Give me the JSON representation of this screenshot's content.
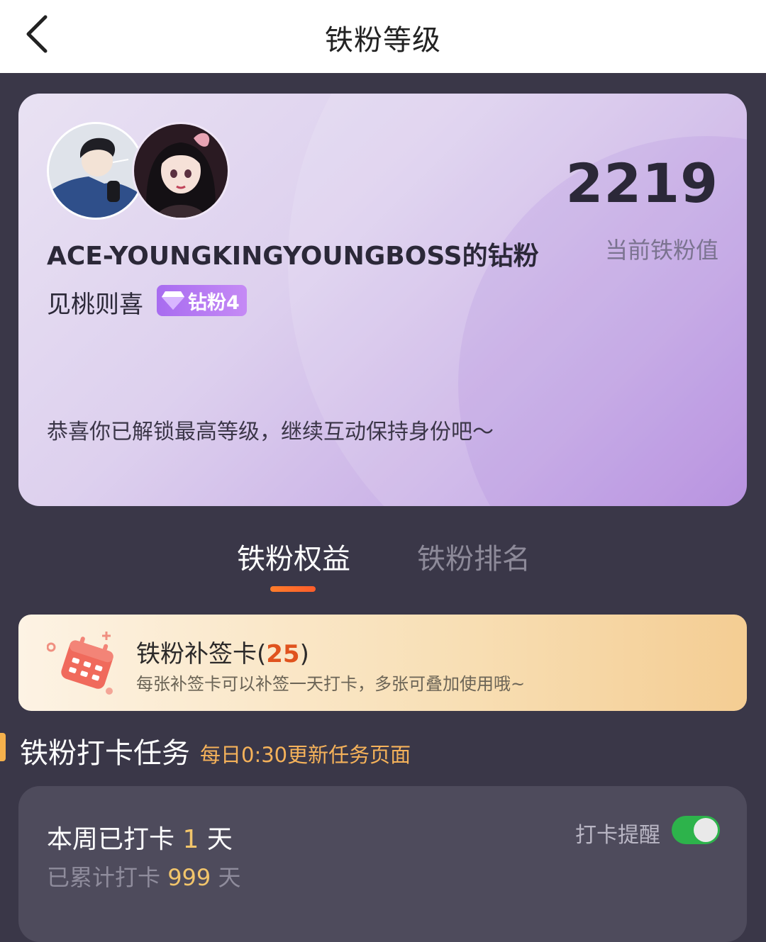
{
  "header": {
    "title": "铁粉等级",
    "back_icon": "chevron-left-icon"
  },
  "hero": {
    "fan_value": "2219",
    "fan_value_label": "当前铁粉值",
    "anchor_fans_title": "ACE-YOUNGKINGYOUNGBOSS的钻粉",
    "username": "见桃则喜",
    "level_badge": "钻粉4",
    "level_icon": "diamond-icon",
    "congrats": "恭喜你已解锁最高等级，继续互动保持身份吧～",
    "colors": {
      "gradient_start": "#e9e2f3",
      "gradient_end": "#b68ddf"
    }
  },
  "tabs": [
    {
      "label": "铁粉权益",
      "active": true
    },
    {
      "label": "铁粉排名",
      "active": false
    }
  ],
  "makeup_card": {
    "title": "铁粉补签卡",
    "count": "25",
    "description": "每张补签卡可以补签一天打卡，多张可叠加使用哦~",
    "icon": "calendar-icon"
  },
  "tasks_section": {
    "title": "铁粉打卡任务",
    "subtitle": "每日0:30更新任务页面"
  },
  "checkin": {
    "week_prefix": "本周已打卡",
    "week_days": "1",
    "day_unit": "天",
    "total_prefix": "已累计打卡",
    "total_days": "999",
    "reminder_label": "打卡提醒",
    "reminder_on": true
  },
  "colors": {
    "accent_orange": "#ff6a2b",
    "gold": "#f2c56b",
    "toggle_green": "#2db34b",
    "background": "#3a3748"
  }
}
